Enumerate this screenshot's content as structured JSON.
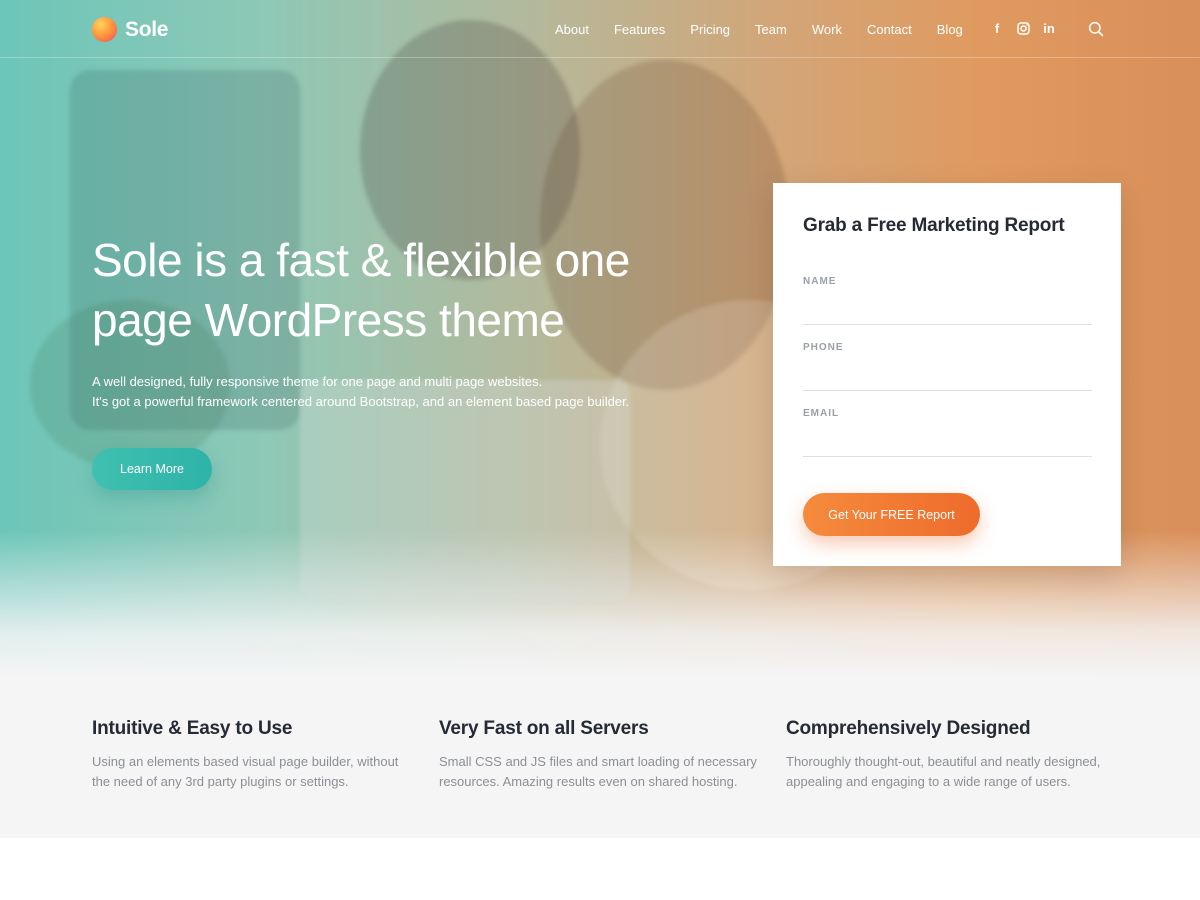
{
  "brand": {
    "name": "Sole"
  },
  "nav": {
    "items": [
      "About",
      "Features",
      "Pricing",
      "Team",
      "Work",
      "Contact",
      "Blog"
    ],
    "socials": [
      {
        "icon": "facebook-icon",
        "glyph": "f"
      },
      {
        "icon": "instagram-icon",
        "glyph": "◎"
      },
      {
        "icon": "linkedin-icon",
        "glyph": "in"
      }
    ],
    "search_icon": "search-icon"
  },
  "hero": {
    "title": "Sole is a fast & flexible one page WordPress theme",
    "subtitle_line1": "A well designed, fully responsive theme for one page and multi page websites.",
    "subtitle_line2": "It's got a powerful framework centered around Bootstrap, and an element based page builder.",
    "button": "Learn More"
  },
  "form": {
    "title": "Grab a Free Marketing Report",
    "fields": [
      {
        "label": "NAME",
        "value": ""
      },
      {
        "label": "PHONE",
        "value": ""
      },
      {
        "label": "EMAIL",
        "value": ""
      }
    ],
    "submit": "Get Your FREE Report"
  },
  "features": [
    {
      "title": "Intuitive & Easy to Use",
      "text": "Using an elements based visual page builder, without the need of any 3rd party plugins or settings."
    },
    {
      "title": "Very Fast on all Servers",
      "text": "Small CSS and JS files and smart loading of necessary resources. Amazing results even on shared hosting."
    },
    {
      "title": "Comprehensively Designed",
      "text": "Thoroughly thought-out, beautiful and neatly designed, appealing and engaging to a wide range of users."
    }
  ],
  "colors": {
    "accent_teal": "#2eb3a8",
    "accent_orange": "#ee6b2b",
    "heading": "#252a35",
    "muted_text": "#8b8f96"
  }
}
